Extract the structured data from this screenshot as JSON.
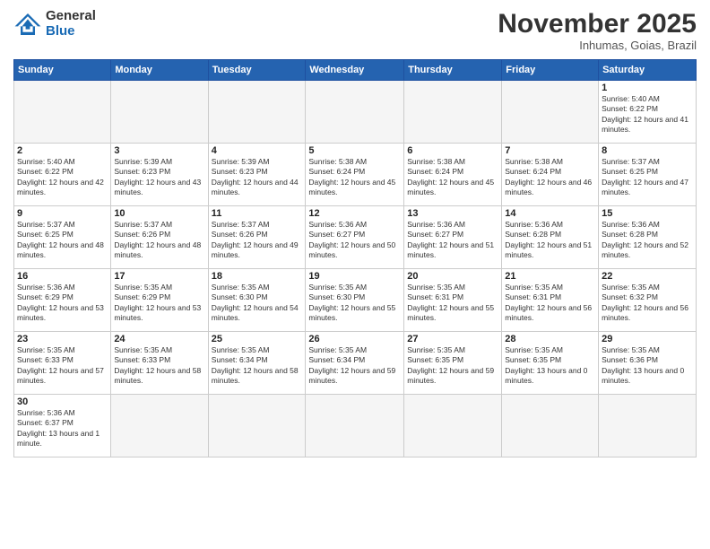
{
  "logo": {
    "text_general": "General",
    "text_blue": "Blue"
  },
  "title": "November 2025",
  "subtitle": "Inhumas, Goias, Brazil",
  "days_of_week": [
    "Sunday",
    "Monday",
    "Tuesday",
    "Wednesday",
    "Thursday",
    "Friday",
    "Saturday"
  ],
  "weeks": [
    [
      {
        "day": "",
        "info": ""
      },
      {
        "day": "",
        "info": ""
      },
      {
        "day": "",
        "info": ""
      },
      {
        "day": "",
        "info": ""
      },
      {
        "day": "",
        "info": ""
      },
      {
        "day": "",
        "info": ""
      },
      {
        "day": "1",
        "info": "Sunrise: 5:40 AM\nSunset: 6:22 PM\nDaylight: 12 hours and 41 minutes."
      }
    ],
    [
      {
        "day": "2",
        "info": "Sunrise: 5:40 AM\nSunset: 6:22 PM\nDaylight: 12 hours and 42 minutes."
      },
      {
        "day": "3",
        "info": "Sunrise: 5:39 AM\nSunset: 6:23 PM\nDaylight: 12 hours and 43 minutes."
      },
      {
        "day": "4",
        "info": "Sunrise: 5:39 AM\nSunset: 6:23 PM\nDaylight: 12 hours and 44 minutes."
      },
      {
        "day": "5",
        "info": "Sunrise: 5:38 AM\nSunset: 6:24 PM\nDaylight: 12 hours and 45 minutes."
      },
      {
        "day": "6",
        "info": "Sunrise: 5:38 AM\nSunset: 6:24 PM\nDaylight: 12 hours and 45 minutes."
      },
      {
        "day": "7",
        "info": "Sunrise: 5:38 AM\nSunset: 6:24 PM\nDaylight: 12 hours and 46 minutes."
      },
      {
        "day": "8",
        "info": "Sunrise: 5:37 AM\nSunset: 6:25 PM\nDaylight: 12 hours and 47 minutes."
      }
    ],
    [
      {
        "day": "9",
        "info": "Sunrise: 5:37 AM\nSunset: 6:25 PM\nDaylight: 12 hours and 48 minutes."
      },
      {
        "day": "10",
        "info": "Sunrise: 5:37 AM\nSunset: 6:26 PM\nDaylight: 12 hours and 48 minutes."
      },
      {
        "day": "11",
        "info": "Sunrise: 5:37 AM\nSunset: 6:26 PM\nDaylight: 12 hours and 49 minutes."
      },
      {
        "day": "12",
        "info": "Sunrise: 5:36 AM\nSunset: 6:27 PM\nDaylight: 12 hours and 50 minutes."
      },
      {
        "day": "13",
        "info": "Sunrise: 5:36 AM\nSunset: 6:27 PM\nDaylight: 12 hours and 51 minutes."
      },
      {
        "day": "14",
        "info": "Sunrise: 5:36 AM\nSunset: 6:28 PM\nDaylight: 12 hours and 51 minutes."
      },
      {
        "day": "15",
        "info": "Sunrise: 5:36 AM\nSunset: 6:28 PM\nDaylight: 12 hours and 52 minutes."
      }
    ],
    [
      {
        "day": "16",
        "info": "Sunrise: 5:36 AM\nSunset: 6:29 PM\nDaylight: 12 hours and 53 minutes."
      },
      {
        "day": "17",
        "info": "Sunrise: 5:35 AM\nSunset: 6:29 PM\nDaylight: 12 hours and 53 minutes."
      },
      {
        "day": "18",
        "info": "Sunrise: 5:35 AM\nSunset: 6:30 PM\nDaylight: 12 hours and 54 minutes."
      },
      {
        "day": "19",
        "info": "Sunrise: 5:35 AM\nSunset: 6:30 PM\nDaylight: 12 hours and 55 minutes."
      },
      {
        "day": "20",
        "info": "Sunrise: 5:35 AM\nSunset: 6:31 PM\nDaylight: 12 hours and 55 minutes."
      },
      {
        "day": "21",
        "info": "Sunrise: 5:35 AM\nSunset: 6:31 PM\nDaylight: 12 hours and 56 minutes."
      },
      {
        "day": "22",
        "info": "Sunrise: 5:35 AM\nSunset: 6:32 PM\nDaylight: 12 hours and 56 minutes."
      }
    ],
    [
      {
        "day": "23",
        "info": "Sunrise: 5:35 AM\nSunset: 6:33 PM\nDaylight: 12 hours and 57 minutes."
      },
      {
        "day": "24",
        "info": "Sunrise: 5:35 AM\nSunset: 6:33 PM\nDaylight: 12 hours and 58 minutes."
      },
      {
        "day": "25",
        "info": "Sunrise: 5:35 AM\nSunset: 6:34 PM\nDaylight: 12 hours and 58 minutes."
      },
      {
        "day": "26",
        "info": "Sunrise: 5:35 AM\nSunset: 6:34 PM\nDaylight: 12 hours and 59 minutes."
      },
      {
        "day": "27",
        "info": "Sunrise: 5:35 AM\nSunset: 6:35 PM\nDaylight: 12 hours and 59 minutes."
      },
      {
        "day": "28",
        "info": "Sunrise: 5:35 AM\nSunset: 6:35 PM\nDaylight: 13 hours and 0 minutes."
      },
      {
        "day": "29",
        "info": "Sunrise: 5:35 AM\nSunset: 6:36 PM\nDaylight: 13 hours and 0 minutes."
      }
    ],
    [
      {
        "day": "30",
        "info": "Sunrise: 5:36 AM\nSunset: 6:37 PM\nDaylight: 13 hours and 1 minute."
      },
      {
        "day": "",
        "info": ""
      },
      {
        "day": "",
        "info": ""
      },
      {
        "day": "",
        "info": ""
      },
      {
        "day": "",
        "info": ""
      },
      {
        "day": "",
        "info": ""
      },
      {
        "day": "",
        "info": ""
      }
    ]
  ]
}
